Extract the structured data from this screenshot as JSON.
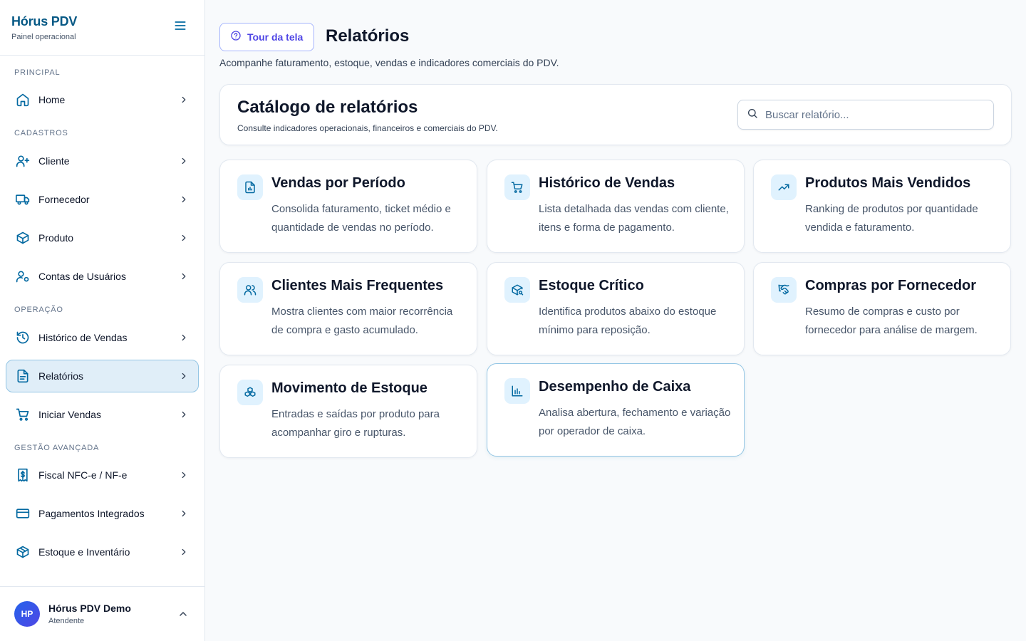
{
  "brand": {
    "title": "Hórus PDV",
    "subtitle": "Painel operacional"
  },
  "sidebar": {
    "sections": [
      {
        "label": "Principal"
      },
      {
        "label": "Cadastros"
      },
      {
        "label": "Operação"
      },
      {
        "label": "Gestão Avançada"
      }
    ],
    "items": [
      {
        "label": "Home",
        "icon": "home-icon"
      },
      {
        "label": "Cliente",
        "icon": "user-plus-icon"
      },
      {
        "label": "Fornecedor",
        "icon": "truck-icon"
      },
      {
        "label": "Produto",
        "icon": "box-icon"
      },
      {
        "label": "Contas de Usuários",
        "icon": "user-cog-icon"
      },
      {
        "label": "Histórico de Vendas",
        "icon": "history-icon"
      },
      {
        "label": "Relatórios",
        "icon": "file-text-icon",
        "active": true
      },
      {
        "label": "Iniciar Vendas",
        "icon": "cart-icon"
      },
      {
        "label": "Fiscal NFC-e / NF-e",
        "icon": "receipt-dollar-icon"
      },
      {
        "label": "Pagamentos Integrados",
        "icon": "credit-card-icon"
      },
      {
        "label": "Estoque e Inventário",
        "icon": "package-icon"
      }
    ]
  },
  "user": {
    "initials": "HP",
    "name": "Hórus PDV Demo",
    "role": "Atendente"
  },
  "header": {
    "tour_label": "Tour da tela",
    "title": "Relatórios",
    "description": "Acompanhe faturamento, estoque, vendas e indicadores comerciais do PDV."
  },
  "catalog": {
    "title": "Catálogo de relatórios",
    "subtitle": "Consulte indicadores operacionais, financeiros e comerciais do PDV.",
    "search_placeholder": "Buscar relatório..."
  },
  "reports": [
    {
      "title": "Vendas por Período",
      "description": "Consolida faturamento, ticket médio e quantidade de vendas no período.",
      "icon": "file-chart-icon"
    },
    {
      "title": "Histórico de Vendas",
      "description": "Lista detalhada das vendas com cliente, itens e forma de pagamento.",
      "icon": "cart-icon"
    },
    {
      "title": "Produtos Mais Vendidos",
      "description": "Ranking de produtos por quantidade vendida e faturamento.",
      "icon": "trending-up-icon"
    },
    {
      "title": "Clientes Mais Frequentes",
      "description": "Mostra clientes com maior recorrência de compra e gasto acumulado.",
      "icon": "users-icon"
    },
    {
      "title": "Estoque Crítico",
      "description": "Identifica produtos abaixo do estoque mínimo para reposição.",
      "icon": "package-search-icon"
    },
    {
      "title": "Compras por Fornecedor",
      "description": "Resumo de compras e custo por fornecedor para análise de margem.",
      "icon": "handshake-icon"
    },
    {
      "title": "Movimento de Estoque",
      "description": "Entradas e saídas por produto para acompanhar giro e rupturas.",
      "icon": "boxes-icon"
    },
    {
      "title": "Desempenho de Caixa",
      "description": "Analisa abertura, fechamento e variação por operador de caixa.",
      "icon": "bar-chart-icon"
    }
  ],
  "colors": {
    "accent": "#0369a1",
    "brand": "#075985",
    "tour": "#4f46e5",
    "active_bg": "#e0eef8"
  }
}
